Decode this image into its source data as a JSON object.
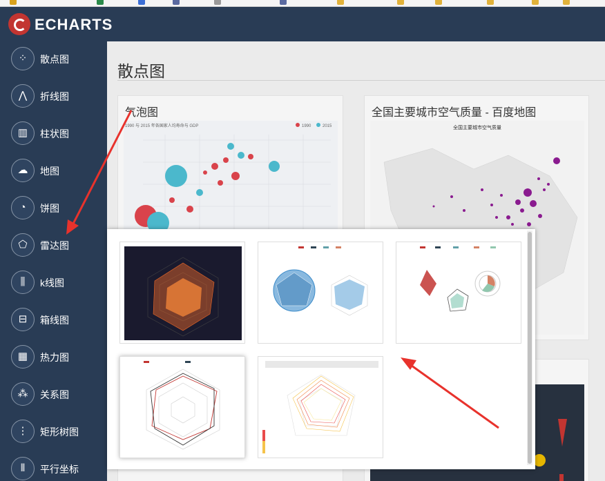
{
  "brand": {
    "logo_text": "ECHARTS"
  },
  "sidebar": {
    "items": [
      {
        "label": "散点图",
        "icon": "scatter-icon"
      },
      {
        "label": "折线图",
        "icon": "line-chart-icon"
      },
      {
        "label": "柱状图",
        "icon": "bar-chart-icon"
      },
      {
        "label": "地图",
        "icon": "map-icon"
      },
      {
        "label": "饼图",
        "icon": "pie-chart-icon"
      },
      {
        "label": "雷达图",
        "icon": "radar-icon"
      },
      {
        "label": "k线图",
        "icon": "candlestick-icon"
      },
      {
        "label": "箱线图",
        "icon": "boxplot-icon"
      },
      {
        "label": "热力图",
        "icon": "heatmap-icon"
      },
      {
        "label": "关系图",
        "icon": "graph-icon"
      },
      {
        "label": "矩形树图",
        "icon": "treemap-icon"
      },
      {
        "label": "平行坐标",
        "icon": "parallel-icon"
      }
    ]
  },
  "main": {
    "page_title": "散点图",
    "cards": [
      {
        "title": "气泡图",
        "chart_caption": "1990 与 2015 年各国家人均寿命与 GDP",
        "legend": [
          "1990",
          "2015"
        ]
      },
      {
        "title": "全国主要城市空气质量 - 百度地图",
        "chart_caption": "全国主要城市空气质量"
      }
    ]
  },
  "popup": {
    "thumbnails": [
      {
        "name": "radar-dark"
      },
      {
        "name": "radar-multiple"
      },
      {
        "name": "radar-aqi"
      },
      {
        "name": "radar-budget"
      },
      {
        "name": "radar-custom"
      }
    ]
  },
  "colors": {
    "sidebar_bg": "#293c55",
    "accent_red": "#c23531",
    "bubble_teal": "#4bb8cc",
    "arrow_red": "#e8322c"
  }
}
